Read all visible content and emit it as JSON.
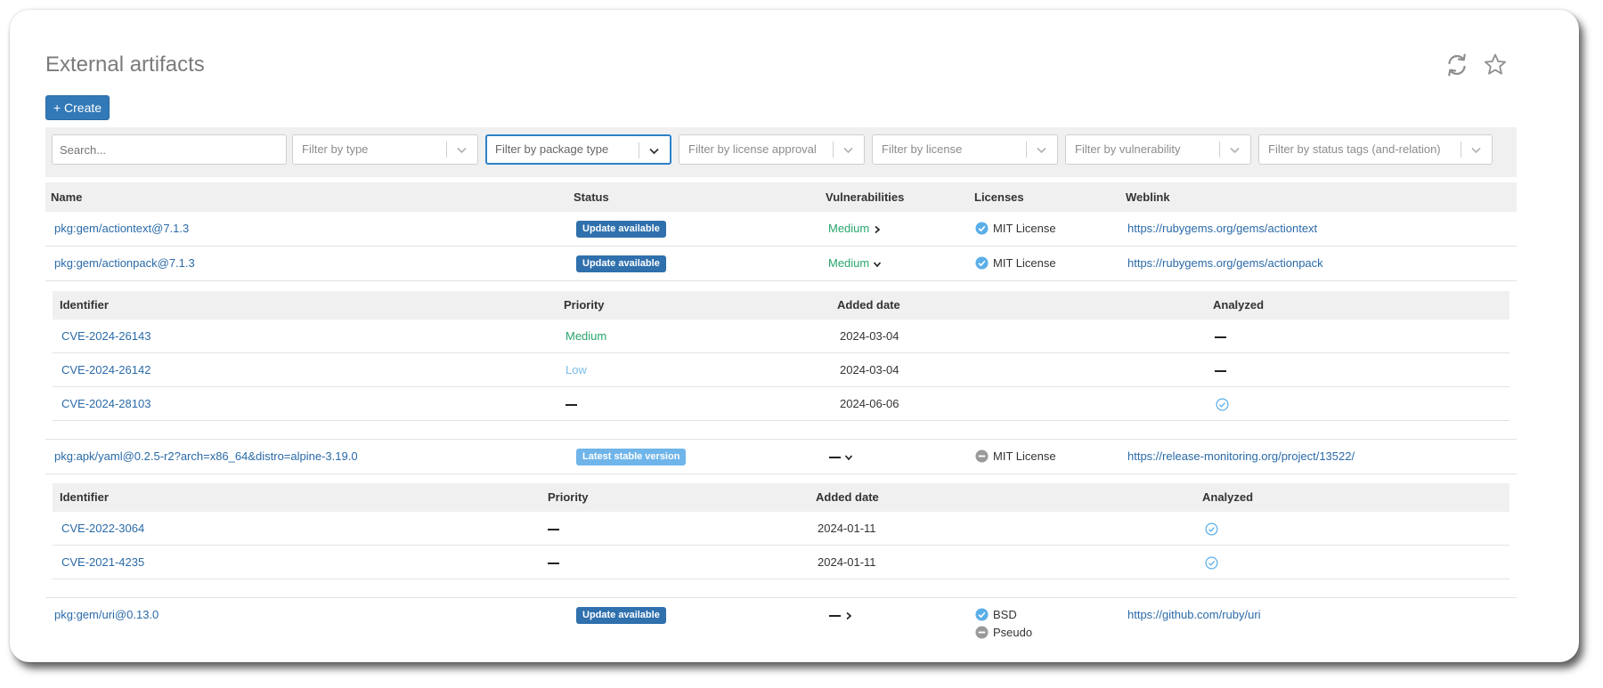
{
  "page": {
    "title": "External artifacts",
    "create_label": "+ Create",
    "refresh_icon": "refresh-icon",
    "favorite_icon": "star-icon"
  },
  "filters": {
    "search_placeholder": "Search...",
    "items": [
      "Filter by type",
      "Filter by package type",
      "Filter by license approval",
      "Filter by license",
      "Filter by vulnerability",
      "Filter by status tags (and-relation)"
    ],
    "active": "Filter by package type"
  },
  "table": {
    "columns": [
      "Name",
      "Status",
      "Vulnerabilities",
      "Licenses",
      "Weblink"
    ],
    "rows": [
      {
        "name": "pkg:gem/actiontext@7.1.3",
        "status": "Update available",
        "vulnerability": "Medium",
        "expanded": false,
        "licenses": [
          {
            "name": "MIT License",
            "state": "approved"
          }
        ],
        "weblink": "https://rubygems.org/gems/actiontext"
      },
      {
        "name": "pkg:gem/actionpack@7.1.3",
        "status": "Update available",
        "vulnerability": "Medium",
        "expanded": true,
        "licenses": [
          {
            "name": "MIT License",
            "state": "approved"
          }
        ],
        "weblink": "https://rubygems.org/gems/actionpack",
        "vulnerabilities": {
          "columns": [
            "Identifier",
            "Priority",
            "Added date",
            "Analyzed"
          ],
          "rows": [
            {
              "id": "CVE-2024-26143",
              "priority": "Medium",
              "added": "2024-03-04",
              "analyzed": false
            },
            {
              "id": "CVE-2024-26142",
              "priority": "Low",
              "added": "2024-03-04",
              "analyzed": false
            },
            {
              "id": "CVE-2024-28103",
              "priority": "",
              "added": "2024-06-06",
              "analyzed": true
            }
          ]
        }
      },
      {
        "name": "pkg:apk/yaml@0.2.5-r2?arch=x86_64&distro=alpine-3.19.0",
        "status": "Latest stable version",
        "vulnerability": "",
        "expanded": true,
        "licenses": [
          {
            "name": "MIT License",
            "state": "unknown"
          }
        ],
        "weblink": "https://release-monitoring.org/project/13522/",
        "vulnerabilities": {
          "columns": [
            "Identifier",
            "Priority",
            "Added date",
            "Analyzed"
          ],
          "rows": [
            {
              "id": "CVE-2022-3064",
              "priority": "",
              "added": "2024-01-11",
              "analyzed": true
            },
            {
              "id": "CVE-2021-4235",
              "priority": "",
              "added": "2024-01-11",
              "analyzed": true
            }
          ]
        }
      },
      {
        "name": "pkg:gem/uri@0.13.0",
        "status": "Update available",
        "vulnerability": "",
        "expanded": false,
        "licenses": [
          {
            "name": "BSD",
            "state": "approved"
          },
          {
            "name": "Pseudo",
            "state": "unknown"
          }
        ],
        "weblink": "https://github.com/ruby/uri"
      }
    ]
  },
  "colors": {
    "primary": "#3279b7",
    "badge_update": "#2f70ad",
    "badge_latest": "#6fb5ea",
    "link": "#2a6aa8",
    "medium": "#28a56d",
    "low": "#79bde8",
    "approved": "#5aaee8",
    "unknown": "#9a9a9a"
  }
}
